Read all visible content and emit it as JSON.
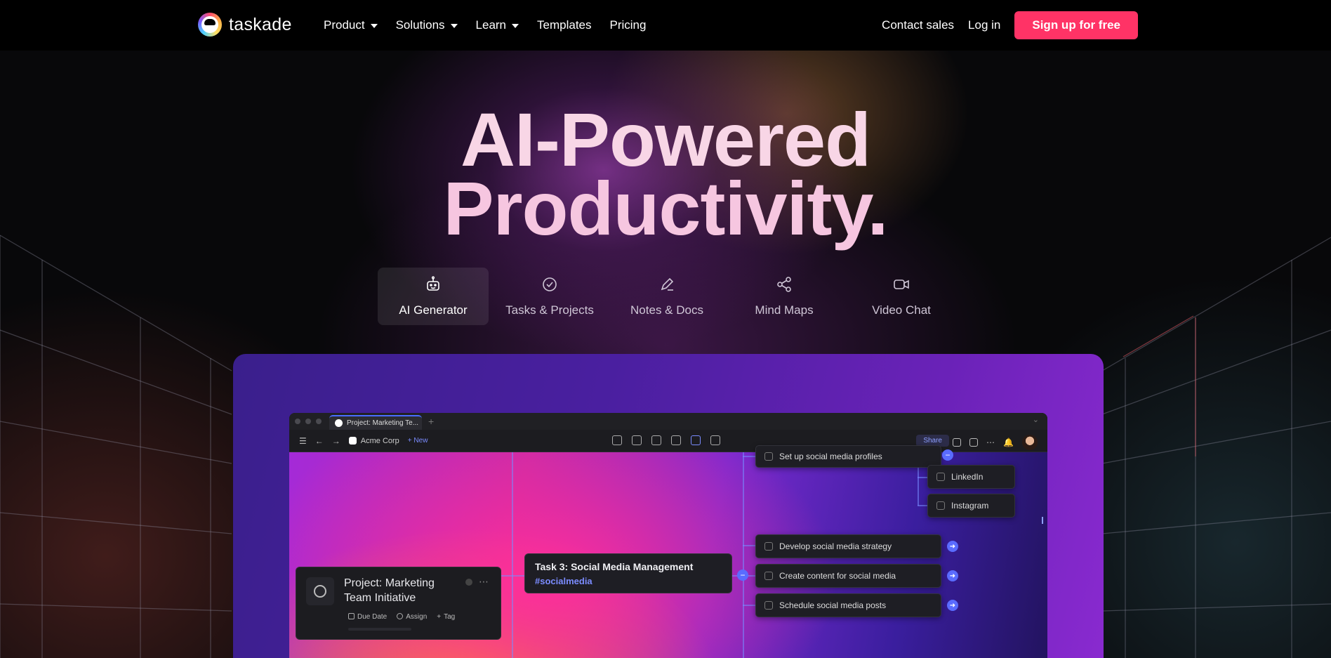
{
  "nav": {
    "logo_text": "taskade",
    "links": [
      {
        "label": "Product",
        "dropdown": true
      },
      {
        "label": "Solutions",
        "dropdown": true
      },
      {
        "label": "Learn",
        "dropdown": true
      },
      {
        "label": "Templates",
        "dropdown": false
      },
      {
        "label": "Pricing",
        "dropdown": false
      }
    ],
    "contact_sales": "Contact sales",
    "login": "Log in",
    "signup": "Sign up for free"
  },
  "hero": {
    "line1": "AI-Powered",
    "line2": "Productivity."
  },
  "tabs": [
    {
      "label": "AI Generator",
      "icon": "robot-icon",
      "active": true
    },
    {
      "label": "Tasks & Projects",
      "icon": "check-circle-icon",
      "active": false
    },
    {
      "label": "Notes & Docs",
      "icon": "pencil-icon",
      "active": false
    },
    {
      "label": "Mind Maps",
      "icon": "share-nodes-icon",
      "active": false
    },
    {
      "label": "Video Chat",
      "icon": "video-camera-icon",
      "active": false
    }
  ],
  "app": {
    "window_tab": "Project: Marketing Te...",
    "workspace": "Acme Corp",
    "new_label": "+ New",
    "share_label": "Share",
    "project_card": {
      "title": "Project: Marketing Team Initiative",
      "due_date": "Due Date",
      "assign": "Assign",
      "tag": "Tag"
    },
    "task_card": {
      "title": "Task 3: Social Media Management",
      "tag": "#socialmedia"
    },
    "subtasks": [
      "Set up social media profiles",
      "Develop social media strategy",
      "Create content for social media",
      "Schedule social media posts"
    ],
    "platforms": [
      "LinkedIn",
      "Instagram"
    ]
  },
  "colors": {
    "accent": "#ff3366",
    "link_blue": "#7b8cff",
    "headline": "#f7d0e4"
  }
}
